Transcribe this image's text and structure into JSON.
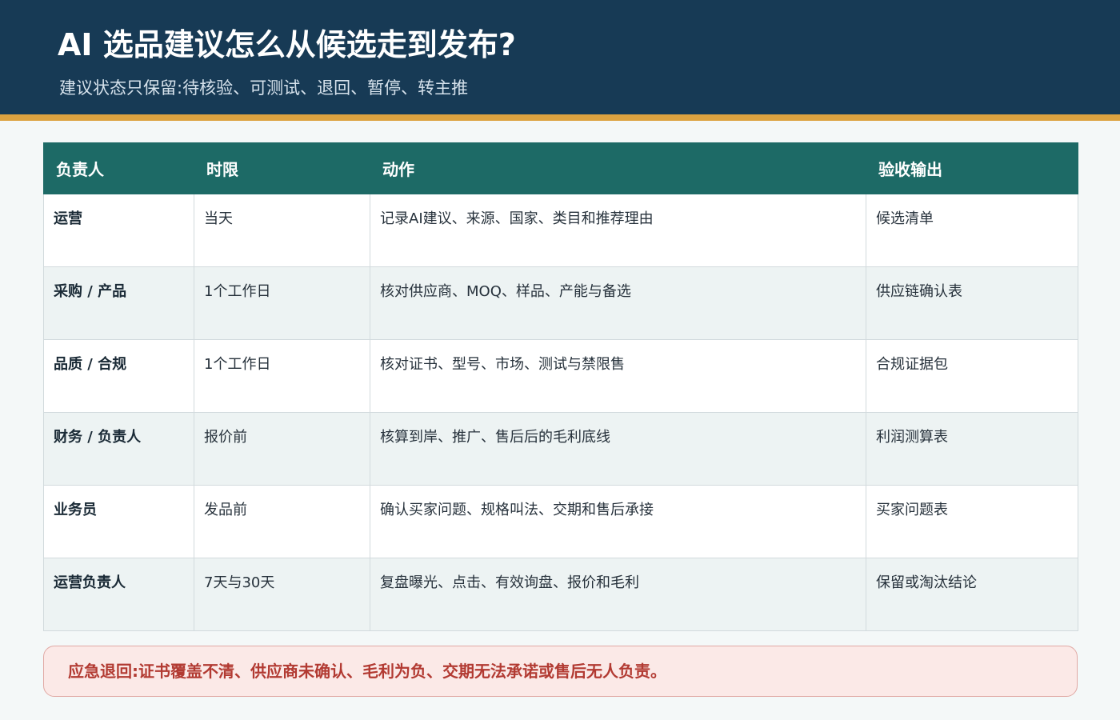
{
  "header": {
    "title": "AI 选品建议怎么从候选走到发布?",
    "subtitle": "建议状态只保留:待核验、可测试、退回、暂停、转主推"
  },
  "table": {
    "columns": [
      "负责人",
      "时限",
      "动作",
      "验收输出"
    ],
    "rows": [
      {
        "owner": "运营",
        "deadline": "当天",
        "action": "记录AI建议、来源、国家、类目和推荐理由",
        "output": "候选清单"
      },
      {
        "owner": "采购 / 产品",
        "deadline": "1个工作日",
        "action": "核对供应商、MOQ、样品、产能与备选",
        "output": "供应链确认表"
      },
      {
        "owner": "品质 / 合规",
        "deadline": "1个工作日",
        "action": "核对证书、型号、市场、测试与禁限售",
        "output": "合规证据包"
      },
      {
        "owner": "财务 / 负责人",
        "deadline": "报价前",
        "action": "核算到岸、推广、售后后的毛利底线",
        "output": "利润测算表"
      },
      {
        "owner": "业务员",
        "deadline": "发品前",
        "action": "确认买家问题、规格叫法、交期和售后承接",
        "output": "买家问题表"
      },
      {
        "owner": "运营负责人",
        "deadline": "7天与30天",
        "action": "复盘曝光、点击、有效询盘、报价和毛利",
        "output": "保留或淘汰结论"
      }
    ]
  },
  "alert": {
    "text": "应急退回:证书覆盖不清、供应商未确认、毛利为负、交期无法承诺或售后无人负责。"
  },
  "colors": {
    "header_bg": "#173a55",
    "accent_stripe": "#dca240",
    "table_header_bg": "#1d6a66",
    "alert_text": "#b23a32",
    "alert_bg": "#fbe9e7"
  }
}
